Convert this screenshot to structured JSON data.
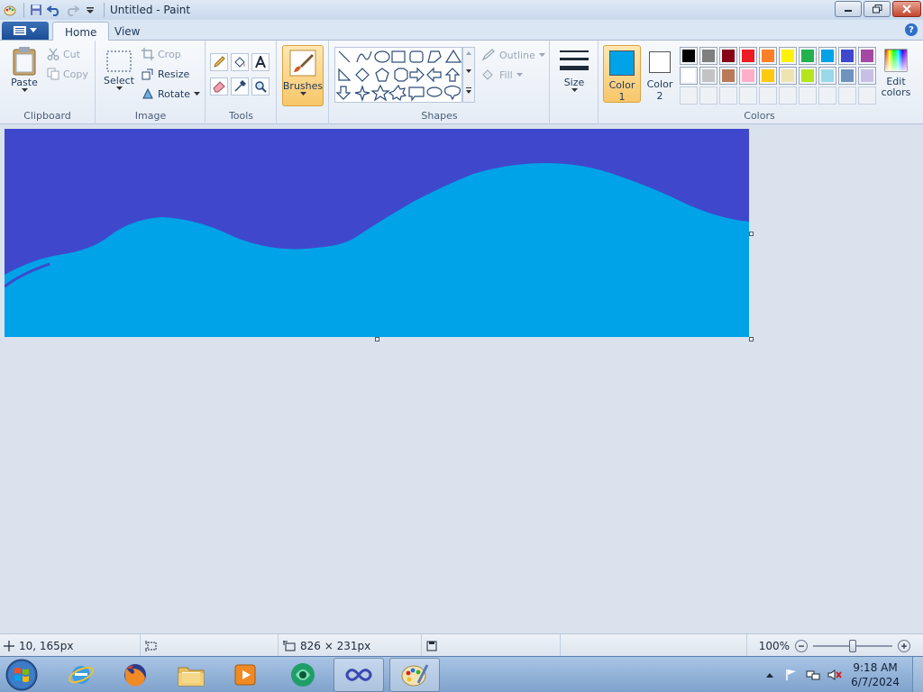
{
  "window": {
    "title": "Untitled - Paint"
  },
  "tabs": [
    {
      "label": "Home"
    },
    {
      "label": "View"
    }
  ],
  "ribbon": {
    "clipboard": {
      "label": "Clipboard",
      "paste": "Paste",
      "cut": "Cut",
      "copy": "Copy"
    },
    "image": {
      "label": "Image",
      "select": "Select",
      "crop": "Crop",
      "resize": "Resize",
      "rotate": "Rotate"
    },
    "tools": {
      "label": "Tools"
    },
    "brushes": {
      "label": "Brushes"
    },
    "shapes": {
      "label": "Shapes",
      "outline": "Outline",
      "fill": "Fill"
    },
    "size": {
      "label": "Size"
    },
    "color1": {
      "label1": "Color",
      "label2": "1",
      "value": "#00a2e8"
    },
    "color2": {
      "label1": "Color",
      "label2": "2",
      "value": "#ffffff"
    },
    "colors": {
      "label": "Colors"
    },
    "edit_colors": {
      "label1": "Edit",
      "label2": "colors"
    }
  },
  "palette": [
    [
      "#000000",
      "#7f7f7f",
      "#880015",
      "#ed1c24",
      "#ff7f27",
      "#fff200",
      "#22b14c",
      "#00a2e8",
      "#3f48cc",
      "#a349a4"
    ],
    [
      "#ffffff",
      "#c3c3c3",
      "#b97a57",
      "#ffaec9",
      "#ffc90e",
      "#efe4b0",
      "#b5e61d",
      "#99d9ea",
      "#7092be",
      "#c8bfe7"
    ]
  ],
  "canvas": {
    "sky_color": "#3f48cc",
    "wave_color": "#00a2e8"
  },
  "status": {
    "cursor_pos": "10, 165px",
    "image_size": "826 × 231px",
    "zoom": "100%"
  },
  "zoom_level": 100,
  "taskbar": {
    "time": "9:18 AM",
    "date": "6/7/2024"
  }
}
